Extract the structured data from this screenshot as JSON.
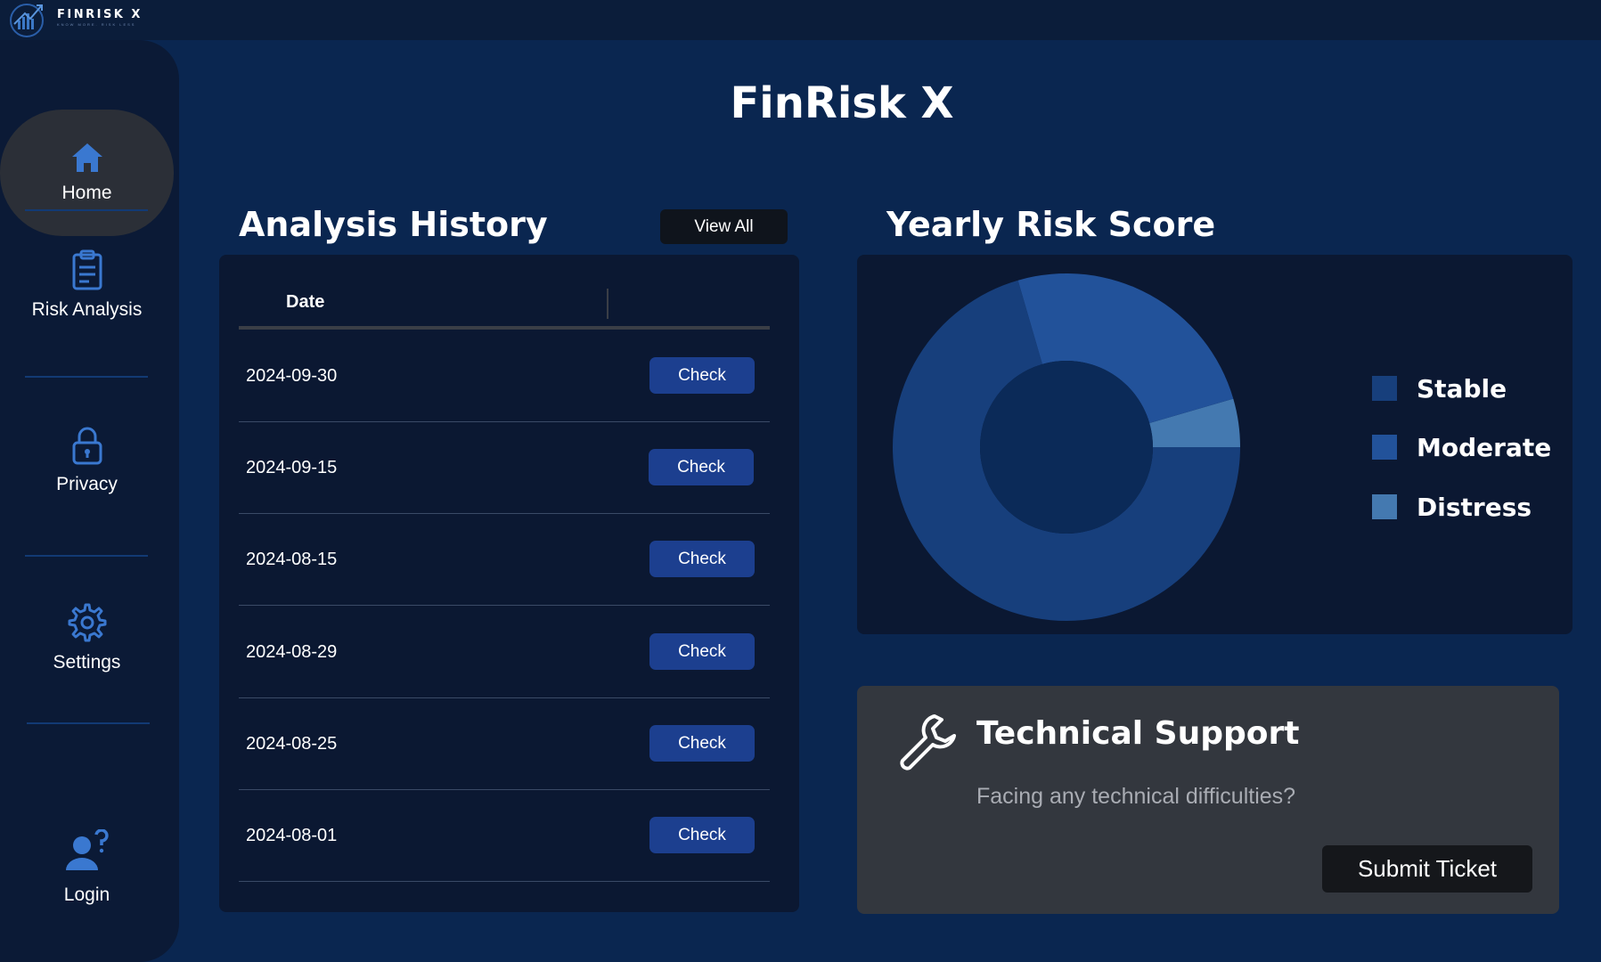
{
  "brand": {
    "logo_text": "FINRISK X",
    "tagline": "KNOW MORE. RISK LESS"
  },
  "sidebar": {
    "items": [
      {
        "label": "Home",
        "icon": "home-icon"
      },
      {
        "label": "Risk Analysis",
        "icon": "clipboard-icon"
      },
      {
        "label": "Privacy",
        "icon": "lock-icon"
      },
      {
        "label": "Settings",
        "icon": "gear-icon"
      },
      {
        "label": "Login",
        "icon": "user-question-icon"
      }
    ],
    "active": "Home"
  },
  "page": {
    "title": "FinRisk X"
  },
  "history": {
    "title": "Analysis History",
    "view_all_label": "View All",
    "column_date": "Date",
    "rows": [
      {
        "date": "2024-09-30",
        "action": "Check"
      },
      {
        "date": "2024-09-15",
        "action": "Check"
      },
      {
        "date": "2024-08-15",
        "action": "Check"
      },
      {
        "date": "2024-08-29",
        "action": "Check"
      },
      {
        "date": "2024-08-25",
        "action": "Check"
      },
      {
        "date": "2024-08-01",
        "action": "Check"
      }
    ]
  },
  "risk_chart": {
    "title": "Yearly Risk Score"
  },
  "chart_data": {
    "type": "pie",
    "title": "Yearly Risk Score",
    "donut": true,
    "categories": [
      "Stable",
      "Moderate",
      "Distress"
    ],
    "values": [
      70.5,
      25,
      4.5
    ],
    "colors": [
      "#173f7c",
      "#22529a",
      "#4479b0"
    ],
    "legend": "right"
  },
  "support": {
    "title": "Technical Support",
    "subtitle": "Facing any technical difficulties?",
    "button_label": "Submit Ticket",
    "icon": "wrench-icon"
  },
  "colors": {
    "background": "#0a2650",
    "sidebar": "#0b1a36",
    "panel": "#0b1832",
    "accent_button": "#1c3f8f",
    "support_panel": "#33373e"
  }
}
